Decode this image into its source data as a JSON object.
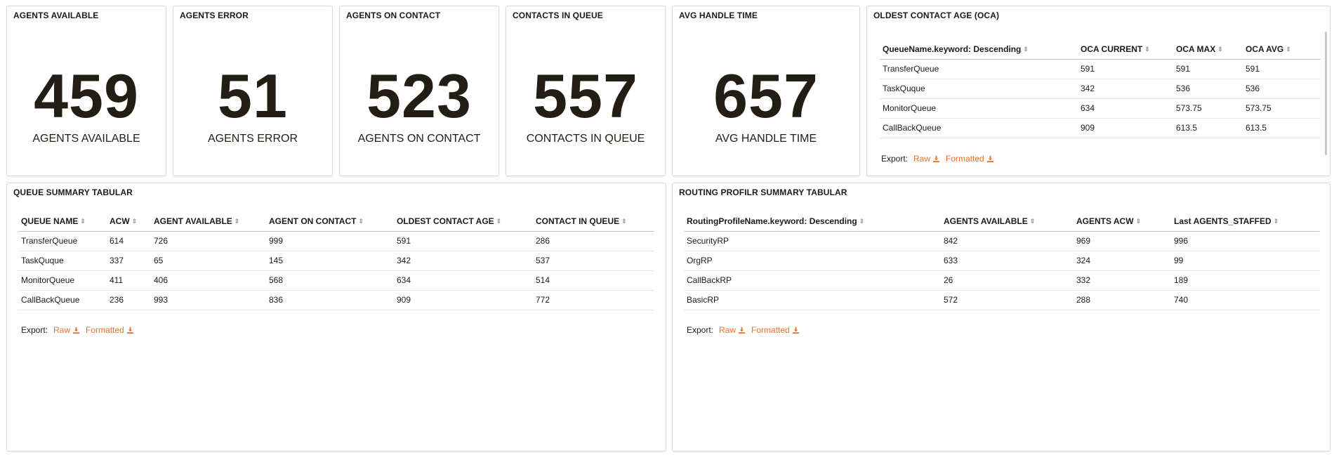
{
  "metrics": [
    {
      "title": "AGENTS AVAILABLE",
      "value": "459",
      "label": "AGENTS AVAILABLE"
    },
    {
      "title": "AGENTS ERROR",
      "value": "51",
      "label": "AGENTS ERROR"
    },
    {
      "title": "AGENTS ON CONTACT",
      "value": "523",
      "label": "AGENTS ON CONTACT"
    },
    {
      "title": "CONTACTS IN QUEUE",
      "value": "557",
      "label": "CONTACTS IN QUEUE"
    },
    {
      "title": "AVG HANDLE TIME",
      "value": "657",
      "label": "AVG HANDLE TIME"
    }
  ],
  "oca": {
    "title": "OLDEST CONTACT AGE (OCA)",
    "columns": [
      "QueueName.keyword: Descending",
      "OCA CURRENT",
      "OCA MAX",
      "OCA AVG"
    ],
    "rows": [
      [
        "TransferQueue",
        "591",
        "591",
        "591"
      ],
      [
        "TaskQuque",
        "342",
        "536",
        "536"
      ],
      [
        "MonitorQueue",
        "634",
        "573.75",
        "573.75"
      ],
      [
        "CallBackQueue",
        "909",
        "613.5",
        "613.5"
      ]
    ],
    "export_label": "Export:",
    "raw_label": "Raw",
    "formatted_label": "Formatted"
  },
  "queue_summary": {
    "title": "QUEUE SUMMARY TABULAR",
    "columns": [
      "QUEUE NAME",
      "ACW",
      "AGENT AVAILABLE",
      "AGENT ON CONTACT",
      "OLDEST CONTACT AGE",
      "CONTACT IN QUEUE"
    ],
    "rows": [
      [
        "TransferQueue",
        "614",
        "726",
        "999",
        "591",
        "286"
      ],
      [
        "TaskQuque",
        "337",
        "65",
        "145",
        "342",
        "537"
      ],
      [
        "MonitorQueue",
        "411",
        "406",
        "568",
        "634",
        "514"
      ],
      [
        "CallBackQueue",
        "236",
        "993",
        "836",
        "909",
        "772"
      ]
    ],
    "export_label": "Export:",
    "raw_label": "Raw",
    "formatted_label": "Formatted"
  },
  "routing_summary": {
    "title": "ROUTING PROFILR SUMMARY TABULAR",
    "columns": [
      "RoutingProfileName.keyword: Descending",
      "AGENTS AVAILABLE",
      "AGENTS ACW",
      "Last AGENTS_STAFFED"
    ],
    "rows": [
      [
        "SecurityRP",
        "842",
        "969",
        "996"
      ],
      [
        "OrgRP",
        "633",
        "324",
        "99"
      ],
      [
        "CallBackRP",
        "26",
        "332",
        "189"
      ],
      [
        "BasicRP",
        "572",
        "288",
        "740"
      ]
    ],
    "export_label": "Export:",
    "raw_label": "Raw",
    "formatted_label": "Formatted"
  },
  "colors": {
    "accent": "#e8702a",
    "metric_text": "#231e14",
    "panel_border": "#d3dae6"
  }
}
